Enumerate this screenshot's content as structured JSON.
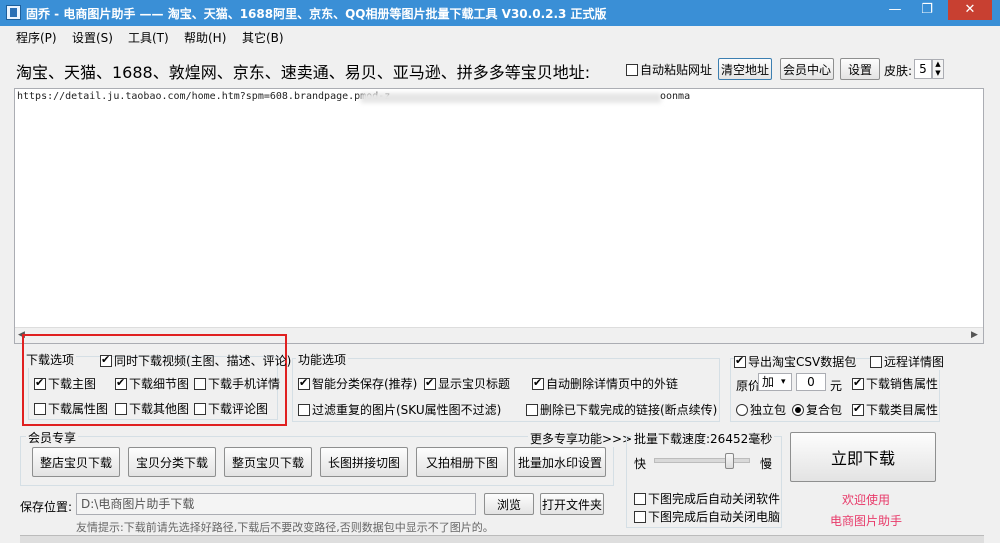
{
  "window": {
    "title": "固乔 - 电商图片助手 —— 淘宝、天猫、1688阿里、京东、QQ相册等图片批量下载工具 V30.0.2.3 正式版",
    "minimize": "—",
    "restore": "❐",
    "close": "✕"
  },
  "menu": [
    "程序(P)",
    "设置(S)",
    "工具(T)",
    "帮助(H)",
    "其它(B)"
  ],
  "header": {
    "platforms_label": "淘宝、天猫、1688、敦煌网、京东、速卖通、易贝、亚马逊、拼多多等宝贝地址:",
    "auto_paste": "自动粘贴网址",
    "clear_button": "清空地址",
    "member_button": "会员中心",
    "settings_button": "设置",
    "skin_label": "皮肤:",
    "skin_value": "5"
  },
  "url_input": {
    "value": "https://detail.ju.taobao.com/home.htm?spm=608.brandpage.pmod-z",
    "tail": "oonma"
  },
  "download_options": {
    "legend": "下载选项",
    "video": "同时下载视频(主图、描述、评论)",
    "main_image": "下载主图",
    "detail_image": "下载细节图",
    "mobile_detail": "下载手机详情",
    "attr_image": "下载属性图",
    "other_image": "下载其他图",
    "review_image": "下载评论图"
  },
  "function_options": {
    "legend": "功能选项",
    "smart_save": "智能分类保存(推荐)",
    "show_title": "显示宝贝标题",
    "remove_external": "自动删除详情页中的外链",
    "filter_dup": "过滤重复的图片(SKU属性图不过滤)",
    "delete_finished": "删除已下载完成的链接(断点续传)"
  },
  "export_options": {
    "csv": "导出淘宝CSV数据包",
    "remote_detail": "远程详情图",
    "price_label": "原价",
    "price_op": "加",
    "price_value": "0",
    "price_unit": "元",
    "sales_attr": "下载销售属性",
    "single_pack": "独立包",
    "multi_pack": "复合包",
    "category_attr": "下载类目属性"
  },
  "member_section": {
    "legend": "会员专享",
    "more": "更多专享功能>>>",
    "buttons": [
      "整店宝贝下载",
      "宝贝分类下载",
      "整页宝贝下载",
      "长图拼接切图",
      "又拍相册下图",
      "批量加水印设置"
    ]
  },
  "speed": {
    "label": "批量下载速度:26452毫秒",
    "fast": "快",
    "slow": "慢",
    "level": 0.83,
    "close_software": "下图完成后自动关闭软件",
    "shutdown": "下图完成后自动关闭电脑"
  },
  "download": {
    "button": "立即下载",
    "welcome": "欢迎使用",
    "brand": "电商图片助手"
  },
  "save": {
    "label": "保存位置:",
    "path": "D:\\电商图片助手下载",
    "browse": "浏览",
    "open_folder": "打开文件夹",
    "tip": "友情提示:下载前请先选择好路径,下载后不要改变路径,否则数据包中显示不了图片的。"
  },
  "colors": {
    "titlebar": "#3a8fd6",
    "highlight": "#e02020",
    "welcome": "#e83a6a"
  }
}
